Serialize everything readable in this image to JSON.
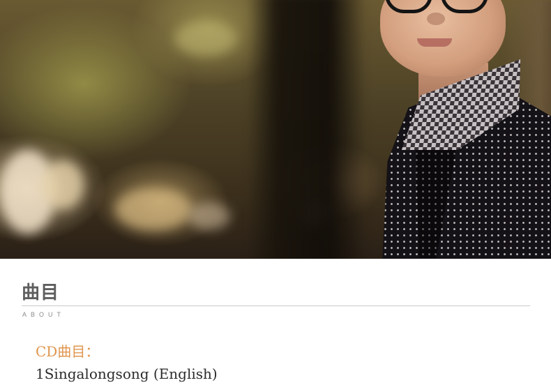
{
  "hero": {
    "alt": "Artist photo: young man with round glasses and dotted coat in front of blurred trees"
  },
  "section": {
    "title": "曲目",
    "subtitle": "ABOUT"
  },
  "tracklist": {
    "heading": "CD曲目：",
    "items": [
      "1Singalongsong (English)"
    ]
  },
  "colors": {
    "heading_orange": "#e0954e",
    "title_gray": "#5e5e5e",
    "divider": "#c9c9c9"
  }
}
